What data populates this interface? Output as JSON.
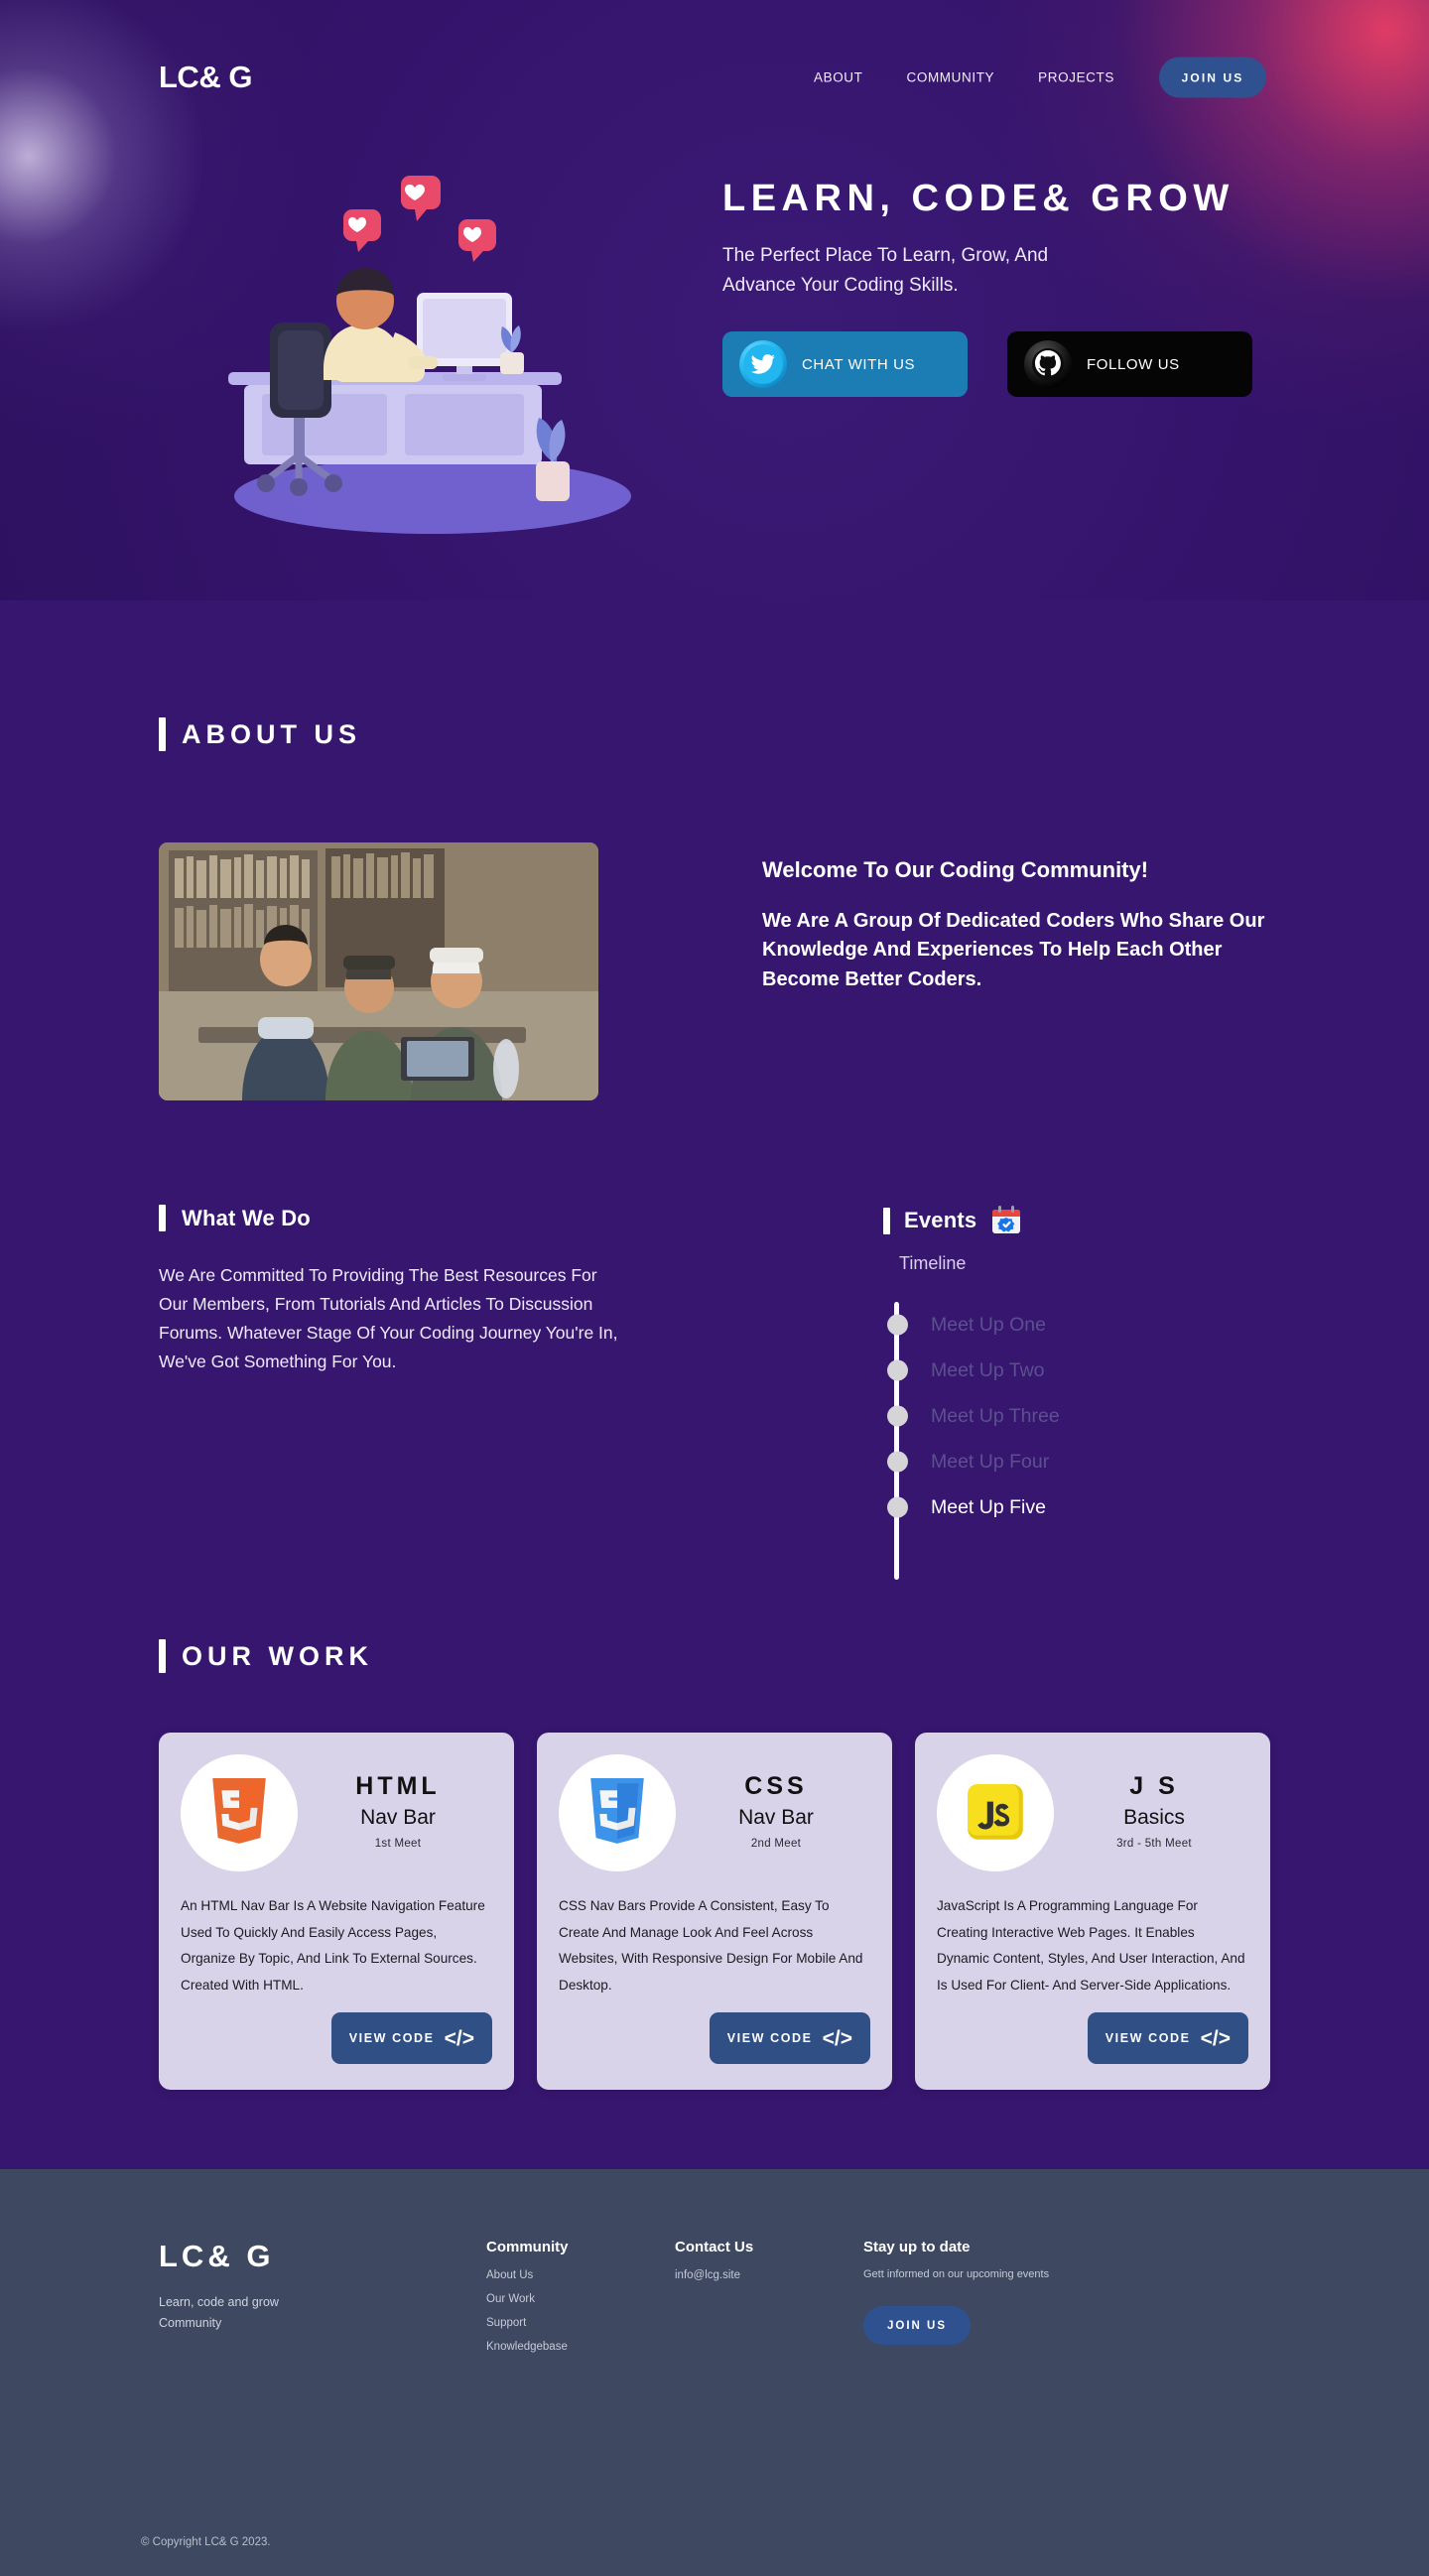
{
  "header": {
    "logo": "LC& G",
    "nav": [
      {
        "label": "ABOUT"
      },
      {
        "label": "COMMUNITY"
      },
      {
        "label": "PROJECTS"
      }
    ],
    "join_label": "JOIN US"
  },
  "hero": {
    "title": "LEARN, CODE& GROW",
    "subtitle": "The Perfect Place To Learn, Grow, And Advance Your Coding Skills.",
    "buttons": [
      {
        "label": "CHAT WITH US",
        "icon": "twitter-icon",
        "color": "#1c7db5"
      },
      {
        "label": "FOLLOW US",
        "icon": "github-icon",
        "color": "#050505"
      }
    ]
  },
  "about": {
    "section_title": "ABOUT US",
    "heading": "Welcome To Our Coding Community!",
    "paragraph": "We Are A Group Of Dedicated Coders Who Share Our Knowledge And Experiences To Help Each Other Become Better Coders."
  },
  "what_we_do": {
    "title": "What We Do",
    "body": "We Are Committed To Providing The Best Resources For Our Members, From Tutorials And Articles To Discussion Forums. Whatever Stage Of Your Coding Journey You're In, We've Got Something For You."
  },
  "events": {
    "title": "Events",
    "icon": "calendar-icon",
    "timeline_label": "Timeline",
    "items": [
      {
        "label": "Meet Up One",
        "active": false
      },
      {
        "label": "Meet Up Two",
        "active": false
      },
      {
        "label": "Meet Up Three",
        "active": false
      },
      {
        "label": "Meet Up Four",
        "active": false
      },
      {
        "label": "Meet Up Five",
        "active": true
      }
    ]
  },
  "work": {
    "section_title": "OUR WORK",
    "view_code_label": "VIEW CODE",
    "cards": [
      {
        "logo": "html5-icon",
        "title": "HTML",
        "subtitle": "Nav Bar",
        "meet": "1st Meet",
        "body": "An HTML Nav Bar Is A Website Navigation Feature Used To Quickly And Easily Access Pages, Organize By Topic, And Link To External Sources. Created With HTML."
      },
      {
        "logo": "css3-icon",
        "title": "CSS",
        "subtitle": "Nav Bar",
        "meet": "2nd  Meet",
        "body": "CSS Nav Bars Provide A Consistent, Easy To Create And Manage Look And Feel Across Websites, With Responsive Design For Mobile And Desktop."
      },
      {
        "logo": "js-icon",
        "title": "J S",
        "subtitle": "Basics",
        "meet": "3rd - 5th  Meet",
        "body": "JavaScript Is A Programming Language For Creating Interactive Web Pages. It Enables Dynamic Content, Styles, And User Interaction, And Is Used For Client- And Server-Side Applications."
      }
    ]
  },
  "footer": {
    "logo": "LC&  G",
    "tagline_line1": "Learn, code and grow",
    "tagline_line2": "Community",
    "community": {
      "heading": "Community",
      "links": [
        {
          "label": "About Us"
        },
        {
          "label": "Our Work"
        },
        {
          "label": "Support"
        },
        {
          "label": "Knowledgebase"
        }
      ]
    },
    "contact": {
      "heading": "Contact Us",
      "email": "info@lcg.site"
    },
    "stay": {
      "heading": "Stay up to date",
      "note": "Gett informed on our upcoming events",
      "join_label": "JOIN US"
    },
    "copyright": "© Copyright LC& G 2023."
  }
}
